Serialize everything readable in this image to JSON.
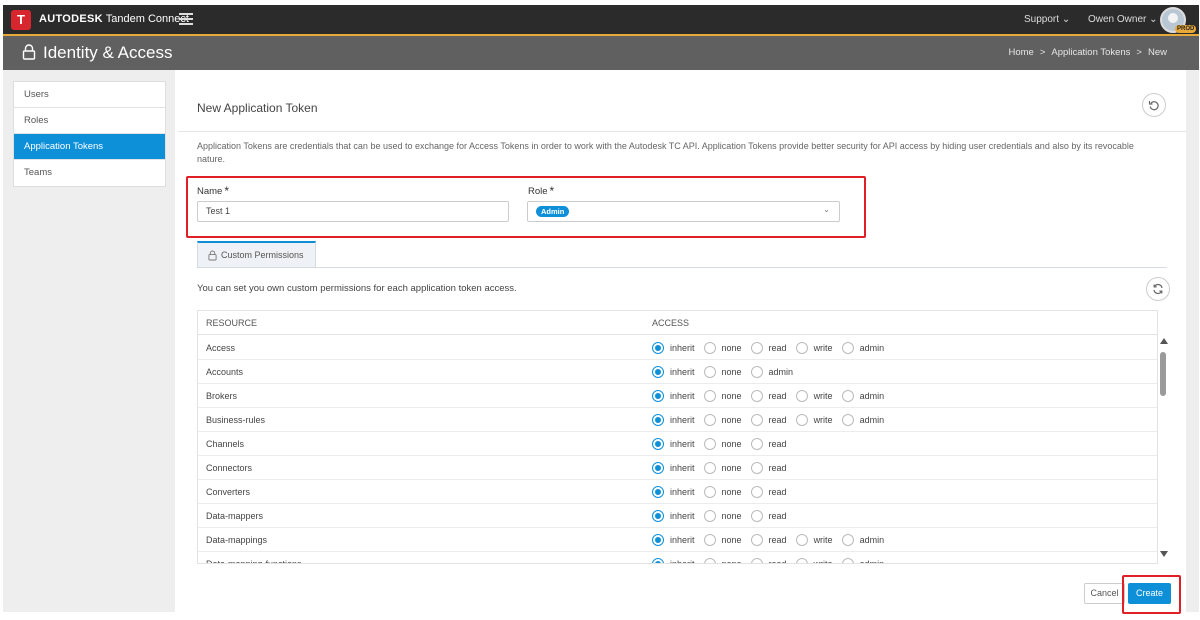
{
  "app": {
    "logo_letter": "T",
    "brand_bold": "AUTODESK",
    "brand_rest": "Tandem Connect",
    "support": "Support",
    "user": "Owen Owner",
    "env_badge": "PROD"
  },
  "header": {
    "title": "Identity & Access",
    "breadcrumb": [
      "Home",
      "Application Tokens",
      "New"
    ],
    "separator": ">"
  },
  "sidebar": {
    "items": [
      {
        "label": "Users",
        "active": false
      },
      {
        "label": "Roles",
        "active": false
      },
      {
        "label": "Application Tokens",
        "active": true
      },
      {
        "label": "Teams",
        "active": false
      }
    ]
  },
  "panel": {
    "title": "New Application Token",
    "description": "Application Tokens are credentials that can be used to exchange for Access Tokens in order to work with the Autodesk TC API. Application Tokens provide better security for API access by hiding user credentials and also by its revocable nature.",
    "name_label": "Name",
    "name_value": "Test 1",
    "role_label": "Role",
    "role_value": "Admin",
    "required_mark": "*",
    "tab_label": "Custom Permissions",
    "permissions_hint": "You can set you own custom permissions for each application token access.",
    "col_resource": "RESOURCE",
    "col_access": "ACCESS",
    "cancel": "Cancel",
    "create": "Create"
  },
  "permissions": [
    {
      "resource": "Access",
      "options": [
        "inherit",
        "none",
        "read",
        "write",
        "admin"
      ],
      "selected": "inherit"
    },
    {
      "resource": "Accounts",
      "options": [
        "inherit",
        "none",
        "admin"
      ],
      "selected": "inherit"
    },
    {
      "resource": "Brokers",
      "options": [
        "inherit",
        "none",
        "read",
        "write",
        "admin"
      ],
      "selected": "inherit"
    },
    {
      "resource": "Business-rules",
      "options": [
        "inherit",
        "none",
        "read",
        "write",
        "admin"
      ],
      "selected": "inherit"
    },
    {
      "resource": "Channels",
      "options": [
        "inherit",
        "none",
        "read"
      ],
      "selected": "inherit"
    },
    {
      "resource": "Connectors",
      "options": [
        "inherit",
        "none",
        "read"
      ],
      "selected": "inherit"
    },
    {
      "resource": "Converters",
      "options": [
        "inherit",
        "none",
        "read"
      ],
      "selected": "inherit"
    },
    {
      "resource": "Data-mappers",
      "options": [
        "inherit",
        "none",
        "read"
      ],
      "selected": "inherit"
    },
    {
      "resource": "Data-mappings",
      "options": [
        "inherit",
        "none",
        "read",
        "write",
        "admin"
      ],
      "selected": "inherit"
    },
    {
      "resource": "Data-mapping-functions",
      "options": [
        "inherit",
        "none",
        "read",
        "write",
        "admin"
      ],
      "selected": "inherit"
    }
  ],
  "colors": {
    "accent": "#0e90d8",
    "highlight": "#e01f26",
    "topbar": "#2b2b2b",
    "header": "#606060",
    "topbar_border": "#e8a93b"
  }
}
